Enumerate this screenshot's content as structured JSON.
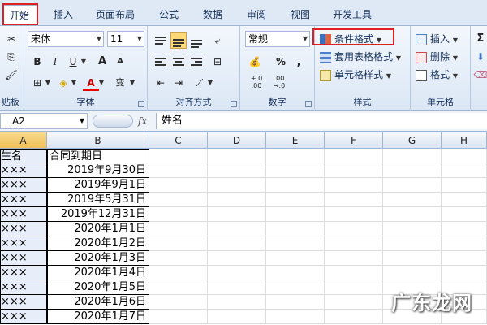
{
  "tabs": [
    "开始",
    "插入",
    "页面布局",
    "公式",
    "数据",
    "审阅",
    "视图",
    "开发工具"
  ],
  "font": {
    "name": "宋体",
    "size": "11",
    "bold": "B",
    "italic": "I",
    "underline": "U",
    "grow": "A",
    "shrink": "A",
    "font_color": "A",
    "wen": "变"
  },
  "number": {
    "format": "常规",
    "percent": "%",
    "comma": ",",
    "inc_decimal": "+.0 .00",
    "dec_decimal": ".00 →.0"
  },
  "styles": {
    "conditional": "条件格式",
    "table_format": "套用表格格式",
    "cell_style": "单元格样式"
  },
  "cells": {
    "insert": "插入",
    "delete": "删除",
    "format": "格式"
  },
  "editing": {
    "sum": "Σ"
  },
  "group_labels": {
    "clipboard": "贴板",
    "font": "字体",
    "alignment": "对齐方式",
    "number": "数字",
    "styles": "样式",
    "cells": "单元格"
  },
  "formula_bar": {
    "name_box": "A2",
    "fx": "fx",
    "content": "姓名"
  },
  "columns": [
    "A",
    "B",
    "C",
    "D",
    "E",
    "F",
    "G",
    "H"
  ],
  "rows": [
    {
      "a": "生名",
      "b": "合同到期日"
    },
    {
      "a": "×××",
      "b": "2019年9月30日"
    },
    {
      "a": "×××",
      "b": "2019年9月1日"
    },
    {
      "a": "×××",
      "b": "2019年5月31日"
    },
    {
      "a": "×××",
      "b": "2019年12月31日"
    },
    {
      "a": "×××",
      "b": "2020年1月1日"
    },
    {
      "a": "×××",
      "b": "2020年1月2日"
    },
    {
      "a": "×××",
      "b": "2020年1月3日"
    },
    {
      "a": "×××",
      "b": "2020年1月4日"
    },
    {
      "a": "×××",
      "b": "2020年1月5日"
    },
    {
      "a": "×××",
      "b": "2020年1月6日"
    },
    {
      "a": "×××",
      "b": "2020年1月7日"
    }
  ],
  "watermark": "广东龙网"
}
